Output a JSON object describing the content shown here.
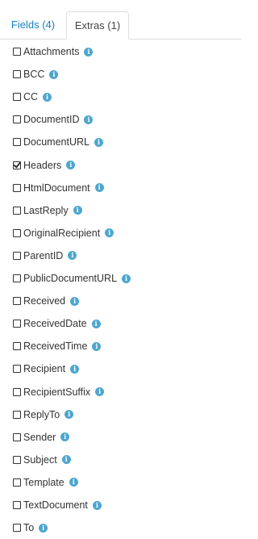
{
  "tabs": [
    {
      "label": "Fields (4)",
      "active": false
    },
    {
      "label": "Extras (1)",
      "active": true
    }
  ],
  "info_icon_glyph": "i",
  "colors": {
    "link": "#1a82c4",
    "info_icon": "#4ea6cf",
    "border": "#dddddd"
  },
  "extras": [
    {
      "label": "Attachments",
      "checked": false
    },
    {
      "label": "BCC",
      "checked": false
    },
    {
      "label": "CC",
      "checked": false
    },
    {
      "label": "DocumentID",
      "checked": false
    },
    {
      "label": "DocumentURL",
      "checked": false
    },
    {
      "label": "Headers",
      "checked": true
    },
    {
      "label": "HtmlDocument",
      "checked": false
    },
    {
      "label": "LastReply",
      "checked": false
    },
    {
      "label": "OriginalRecipient",
      "checked": false
    },
    {
      "label": "ParentID",
      "checked": false
    },
    {
      "label": "PublicDocumentURL",
      "checked": false
    },
    {
      "label": "Received",
      "checked": false
    },
    {
      "label": "ReceivedDate",
      "checked": false
    },
    {
      "label": "ReceivedTime",
      "checked": false
    },
    {
      "label": "Recipient",
      "checked": false
    },
    {
      "label": "RecipientSuffix",
      "checked": false
    },
    {
      "label": "ReplyTo",
      "checked": false
    },
    {
      "label": "Sender",
      "checked": false
    },
    {
      "label": "Subject",
      "checked": false
    },
    {
      "label": "Template",
      "checked": false
    },
    {
      "label": "TextDocument",
      "checked": false
    },
    {
      "label": "To",
      "checked": false
    }
  ]
}
